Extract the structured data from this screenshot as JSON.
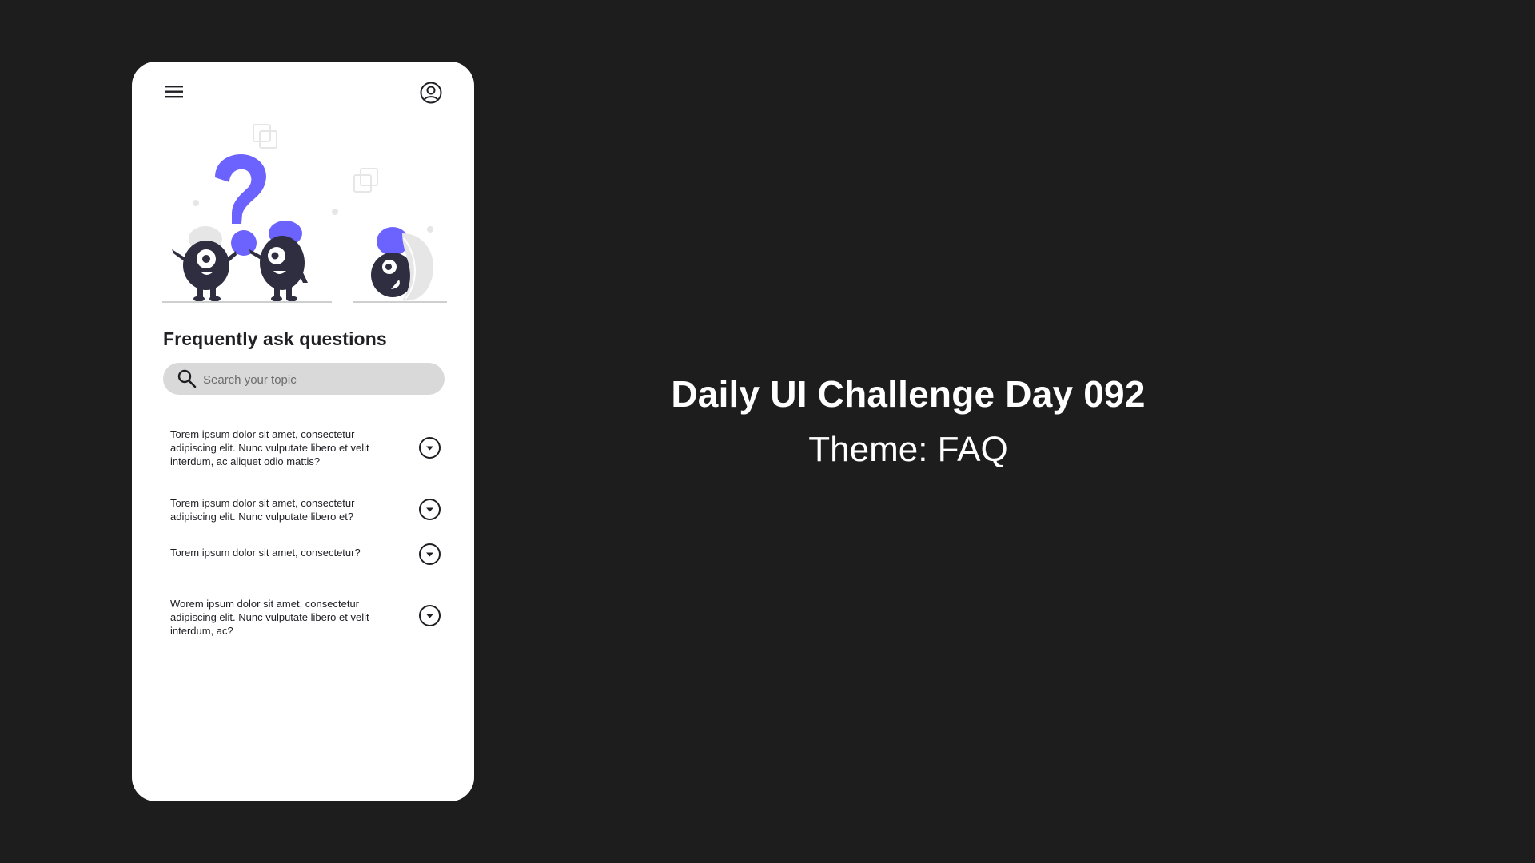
{
  "app": {
    "faq_heading": "Frequently ask questions",
    "search": {
      "placeholder": "Search your topic"
    },
    "faq_items": [
      {
        "question": "Torem ipsum dolor sit amet, consectetur adipiscing elit. Nunc vulputate libero et velit interdum, ac aliquet odio mattis?"
      },
      {
        "question": "Torem ipsum dolor sit amet, consectetur adipiscing elit. Nunc vulputate libero et?"
      },
      {
        "question": "Torem ipsum dolor sit amet, consectetur?"
      },
      {
        "question": "Worem ipsum dolor sit amet, consectetur adipiscing elit. Nunc vulputate libero et velit interdum, ac?"
      }
    ]
  },
  "presentation": {
    "title": "Daily UI Challenge Day 092",
    "theme": "Theme: FAQ"
  },
  "icons": {
    "menu": "hamburger-menu-icon",
    "profile": "user-circle-icon",
    "search": "search-icon",
    "expand": "chevron-down-circle-icon"
  },
  "colors": {
    "background": "#1d1d1d",
    "card": "#ffffff",
    "accent": "#6c63ff",
    "character": "#2f2e41",
    "search_bg": "#d9d9d9"
  }
}
